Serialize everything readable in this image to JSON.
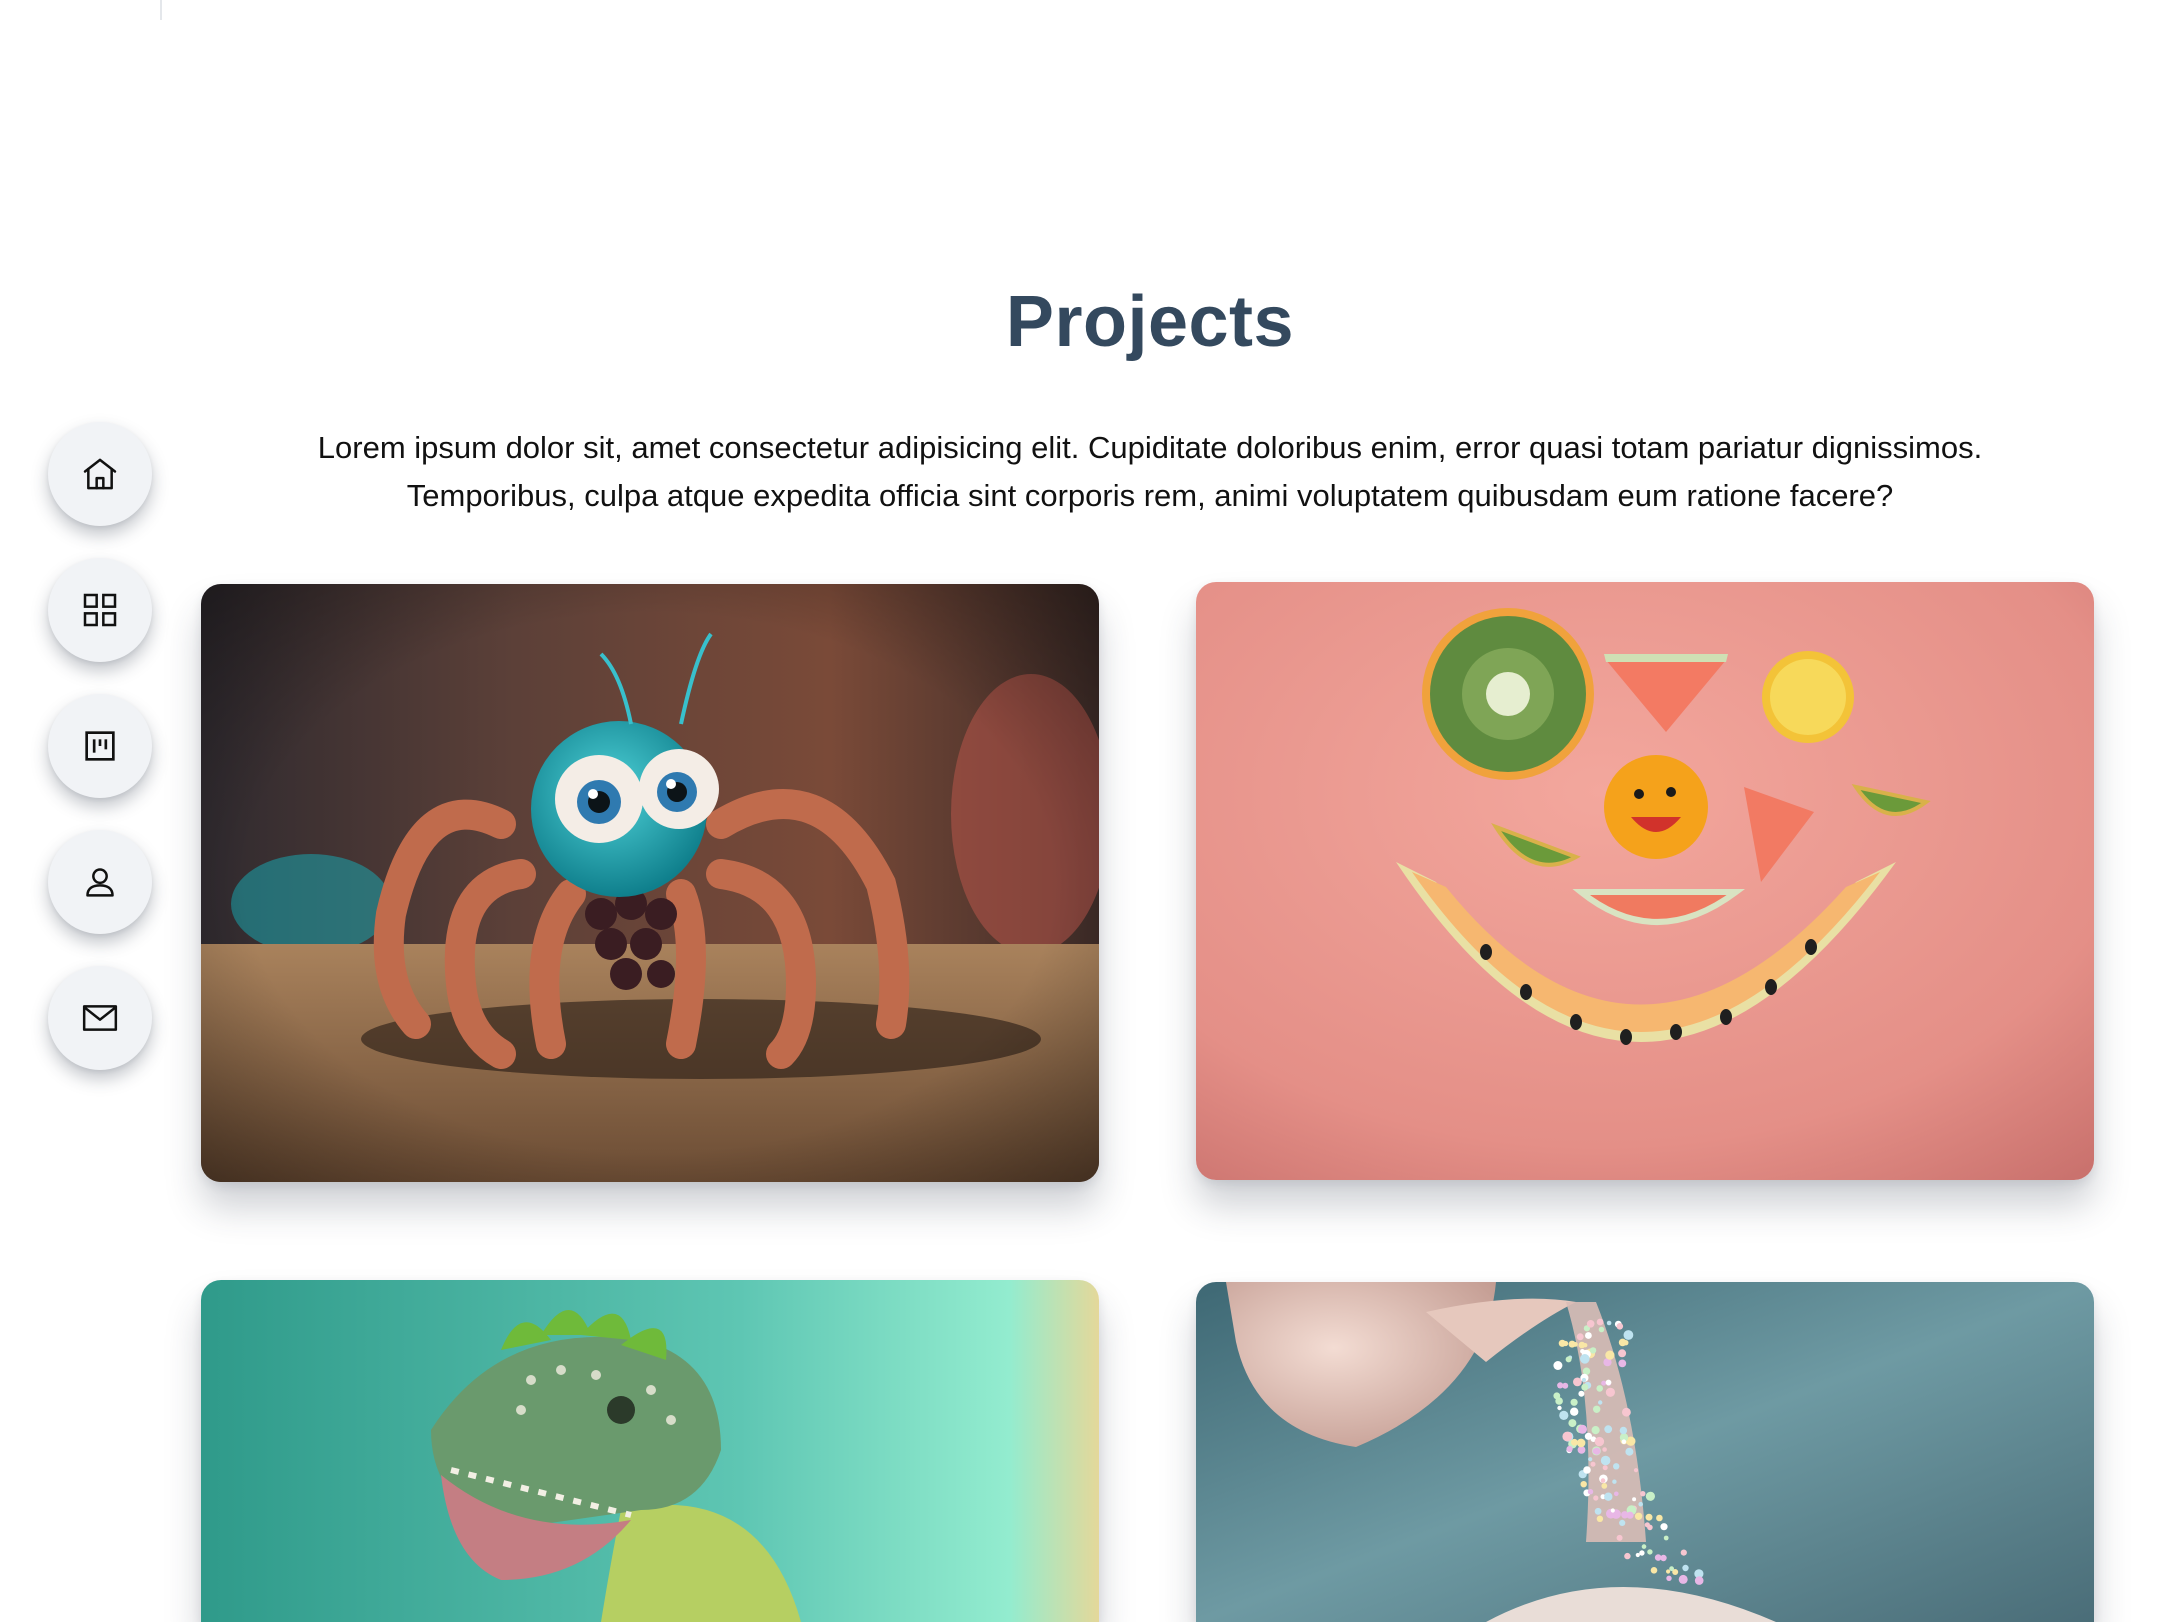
{
  "section": {
    "title": "Projects",
    "description_line1": "Lorem ipsum dolor sit, amet consectetur adipisicing elit. Cupiditate doloribus enim, error quasi totam pariatur dignissimos.",
    "description_line2": "Temporibus, culpa atque expedita officia sint corporis rem, animi voluptatem quibusdam eum ratione facere?"
  },
  "sidenav": {
    "items": [
      {
        "icon": "home-icon"
      },
      {
        "icon": "grid-icon"
      },
      {
        "icon": "kanban-board-icon"
      },
      {
        "icon": "user-icon"
      },
      {
        "icon": "mail-icon"
      }
    ]
  },
  "projects": [
    {
      "image": "fuzzy-spider-figure"
    },
    {
      "image": "fruit-smiley-face"
    },
    {
      "image": "green-dinosaur"
    },
    {
      "image": "teapot-pouring-sprinkles"
    }
  ],
  "colors": {
    "title": "#34495e",
    "nav_button": "#f1f3f6",
    "text": "#111111"
  }
}
